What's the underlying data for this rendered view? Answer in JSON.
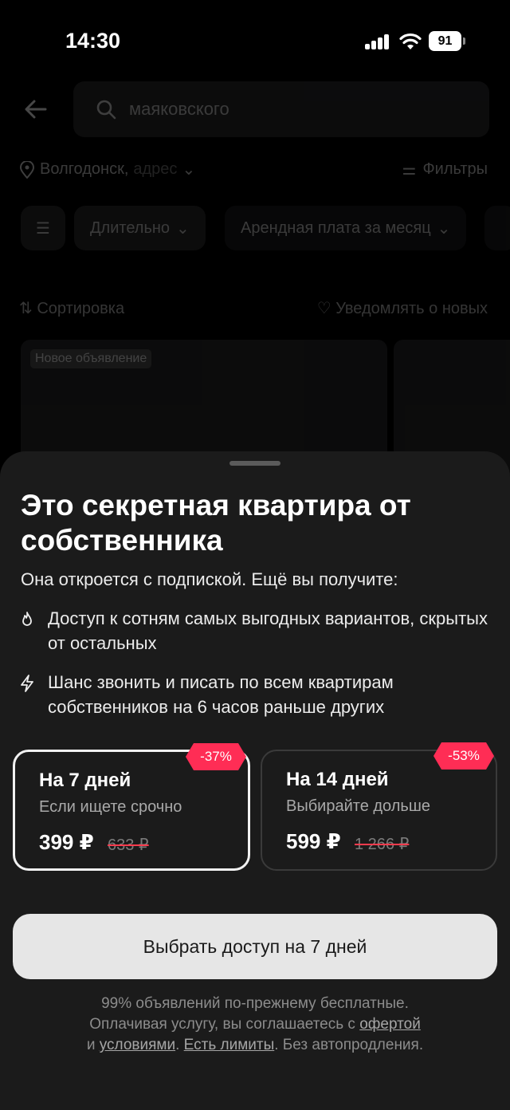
{
  "status_bar": {
    "time": "14:30",
    "battery": "91"
  },
  "background": {
    "search_query": "маяковского",
    "city": "Волгодонск,",
    "address_hint": "адрес",
    "filters_label": "Фильтры",
    "chip_duration": "Длительно",
    "chip_rent": "Арендная плата за месяц",
    "sort_label": "Сортировка",
    "notify_label": "Уведомлять о новых",
    "listing_tag": "Новое объявление"
  },
  "sheet": {
    "title": "Это секретная квартира от собственника",
    "subtitle": "Она откроется с подпиской. Ещё вы получите:",
    "features": [
      {
        "icon": "fire-icon",
        "text": "Доступ к сотням самых выгодных вариантов, скрытых от остальных"
      },
      {
        "icon": "lightning-icon",
        "text": "Шанс звонить и писать по всем квартирам собственников на 6 часов раньше других"
      }
    ],
    "plans": [
      {
        "name": "На 7 дней",
        "hint": "Если ищете срочно",
        "price": "399 ₽",
        "old_price": "633 ₽",
        "discount": "-37%",
        "selected": true
      },
      {
        "name": "На 14 дней",
        "hint": "Выбирайте дольше",
        "price": "599 ₽",
        "old_price": "1 266 ₽",
        "discount": "-53%",
        "selected": false
      }
    ],
    "cta_label": "Выбрать доступ на 7 дней",
    "footer": {
      "line1": "99% объявлений по-прежнему бесплатные.",
      "line2_prefix": "Оплачивая услугу, вы соглашаетесь с ",
      "offer_link": "офертой",
      "line3_and": "и ",
      "terms_link": "условиями",
      "sep": ". ",
      "limits_link": "Есть лимиты",
      "line3_suffix": ". Без автопродления."
    }
  },
  "colors": {
    "accent_badge": "#ff2d55",
    "sheet_bg": "#1b1b1b",
    "cta_bg": "#e6e6e6"
  }
}
